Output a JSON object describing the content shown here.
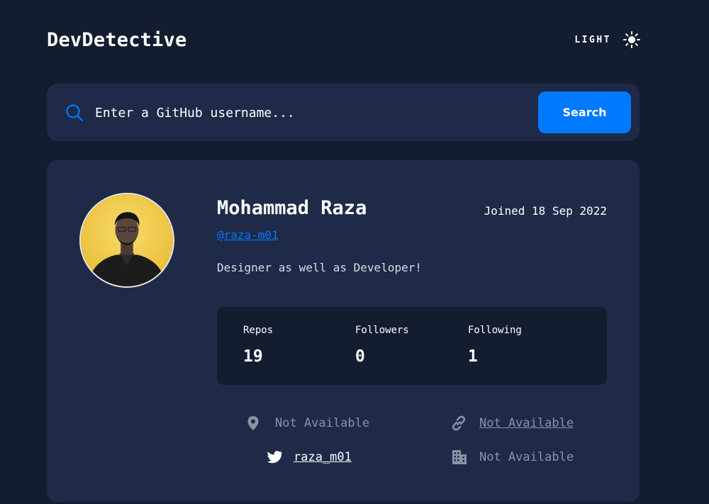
{
  "header": {
    "brand": "DevDetective",
    "theme_label": "LIGHT",
    "theme_icon": "sun-icon"
  },
  "search": {
    "placeholder": "Enter a GitHub username...",
    "button_label": "Search",
    "icon": "search-icon"
  },
  "profile": {
    "name": "Mohammad Raza",
    "joined": "Joined 18 Sep 2022",
    "handle": "@raza-m01",
    "bio": "Designer as well as Developer!",
    "stats": {
      "repos_label": "Repos",
      "repos": "19",
      "followers_label": "Followers",
      "followers": "0",
      "following_label": "Following",
      "following": "1"
    },
    "links": {
      "location": "Not Available",
      "blog": "Not Available",
      "twitter": "raza_m01",
      "company": "Not Available"
    }
  },
  "colors": {
    "background": "#141d2f",
    "card": "#1e2a47",
    "accent": "#0079ff",
    "muted": "#8a93a6"
  }
}
